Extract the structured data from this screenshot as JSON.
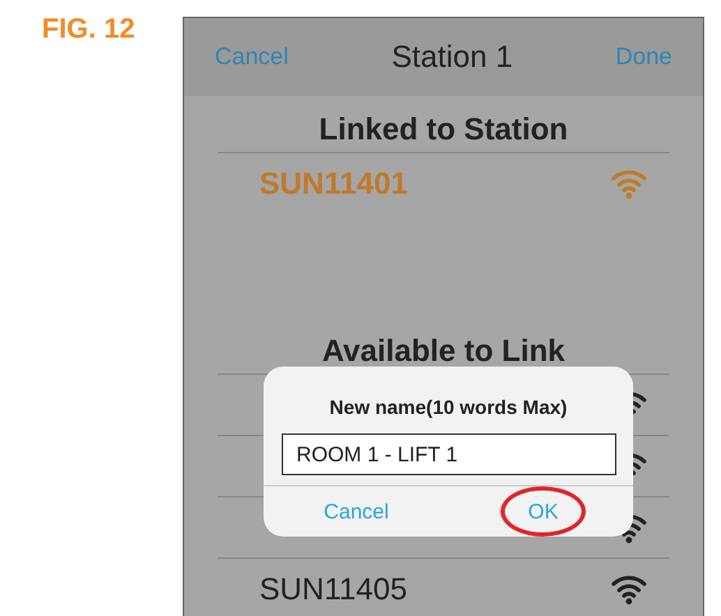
{
  "figure_label": "FIG. 12",
  "nav": {
    "left": "Cancel",
    "title": "Station 1",
    "right": "Done"
  },
  "linked": {
    "heading": "Linked to Station",
    "items": [
      {
        "name": "SUN11401"
      }
    ]
  },
  "available": {
    "heading": "Available to Link",
    "items": [
      {
        "kind": "covered"
      },
      {
        "kind": "covered"
      },
      {
        "kind": "covered"
      },
      {
        "kind": "station",
        "name": "SUN11405"
      }
    ]
  },
  "dialog": {
    "title": "New name(10 words Max)",
    "value": "ROOM 1 - LIFT 1",
    "buttons": [
      {
        "label": "Cancel",
        "highlighted": false
      },
      {
        "label": "OK",
        "highlighted": true
      }
    ]
  }
}
